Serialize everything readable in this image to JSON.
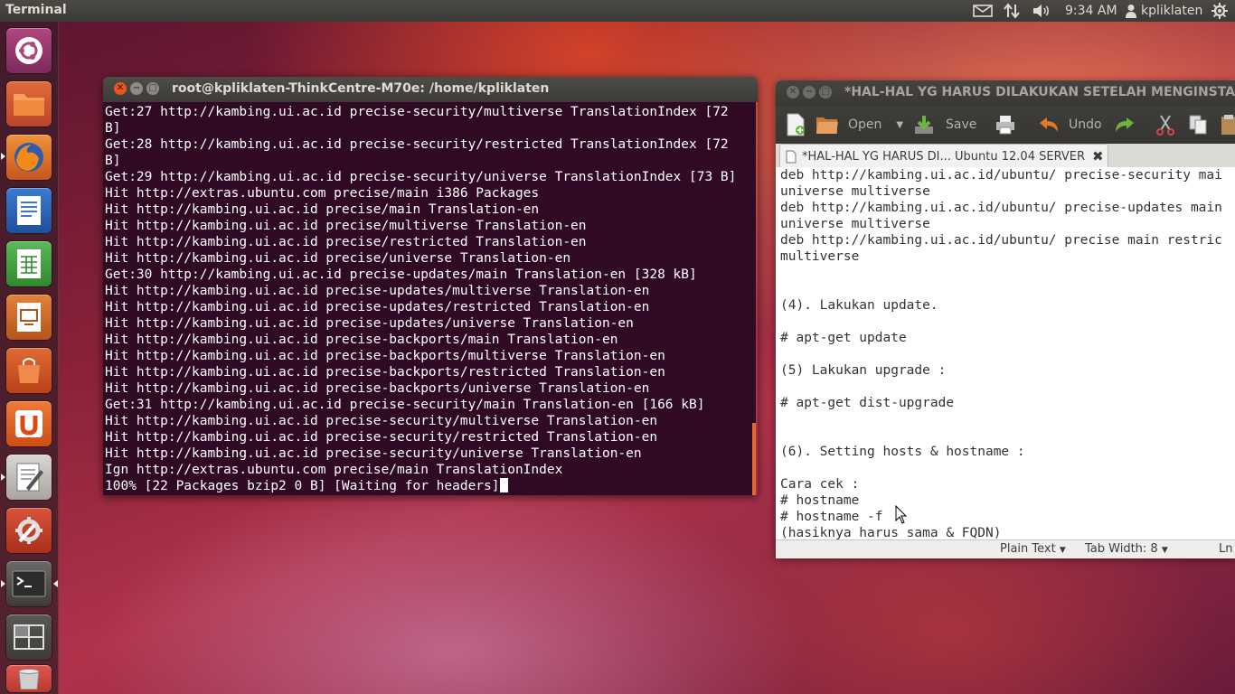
{
  "top_panel": {
    "app_title": "Terminal",
    "clock": "9:34 AM",
    "user": "kpliklaten",
    "icons": [
      "mail-icon",
      "network-icon",
      "volume-icon",
      "power-gear-icon"
    ]
  },
  "launcher": {
    "items": [
      "dash-home",
      "files",
      "firefox",
      "libreoffice-writer",
      "libreoffice-calc",
      "libreoffice-impress",
      "software-center",
      "ubuntu-one",
      "text-editor",
      "system-settings",
      "terminal",
      "workspace-switcher",
      "trash"
    ]
  },
  "terminal": {
    "title": "root@kpliklaten-ThinkCentre-M70e: /home/kpliklaten",
    "output": "Get:27 http://kambing.ui.ac.id precise-security/multiverse TranslationIndex [72\nB]\nGet:28 http://kambing.ui.ac.id precise-security/restricted TranslationIndex [72\nB]\nGet:29 http://kambing.ui.ac.id precise-security/universe TranslationIndex [73 B]\nHit http://extras.ubuntu.com precise/main i386 Packages\nHit http://kambing.ui.ac.id precise/main Translation-en\nHit http://kambing.ui.ac.id precise/multiverse Translation-en\nHit http://kambing.ui.ac.id precise/restricted Translation-en\nHit http://kambing.ui.ac.id precise/universe Translation-en\nGet:30 http://kambing.ui.ac.id precise-updates/main Translation-en [328 kB]\nHit http://kambing.ui.ac.id precise-updates/multiverse Translation-en\nHit http://kambing.ui.ac.id precise-updates/restricted Translation-en\nHit http://kambing.ui.ac.id precise-updates/universe Translation-en\nHit http://kambing.ui.ac.id precise-backports/main Translation-en\nHit http://kambing.ui.ac.id precise-backports/multiverse Translation-en\nHit http://kambing.ui.ac.id precise-backports/restricted Translation-en\nHit http://kambing.ui.ac.id precise-backports/universe Translation-en\nGet:31 http://kambing.ui.ac.id precise-security/main Translation-en [166 kB]\nHit http://kambing.ui.ac.id precise-security/multiverse Translation-en\nHit http://kambing.ui.ac.id precise-security/restricted Translation-en\nHit http://kambing.ui.ac.id precise-security/universe Translation-en\nIgn http://extras.ubuntu.com precise/main TranslationIndex",
    "progress_line": "100% [22 Packages bzip2 0 B] [Waiting for headers]",
    "background_color": "#300a24"
  },
  "gedit": {
    "title": "*HAL-HAL YG HARUS DILAKUKAN SETELAH MENGINSTALL U",
    "toolbar": {
      "open_label": "Open",
      "save_label": "Save",
      "undo_label": "Undo"
    },
    "tab_label": "*HAL-HAL YG HARUS DI... Ubuntu 12.04 SERVER",
    "content": "deb http://kambing.ui.ac.id/ubuntu/ precise-security mai\nuniverse multiverse\ndeb http://kambing.ui.ac.id/ubuntu/ precise-updates main\nuniverse multiverse\ndeb http://kambing.ui.ac.id/ubuntu/ precise main restric\nmultiverse\n\n\n(4). Lakukan update.\n\n# apt-get update\n\n(5) Lakukan upgrade :\n\n# apt-get dist-upgrade\n\n\n(6). Setting hosts & hostname :\n\nCara cek :\n# hostname\n# hostname -f\n(hasiknya harus sama & FQDN)",
    "statusbar": {
      "language": "Plain Text",
      "tab_width": "Tab Width:  8",
      "position": "Ln"
    }
  },
  "colors": {
    "accent_orange": "#dd4814",
    "close_button": "#e95420"
  }
}
